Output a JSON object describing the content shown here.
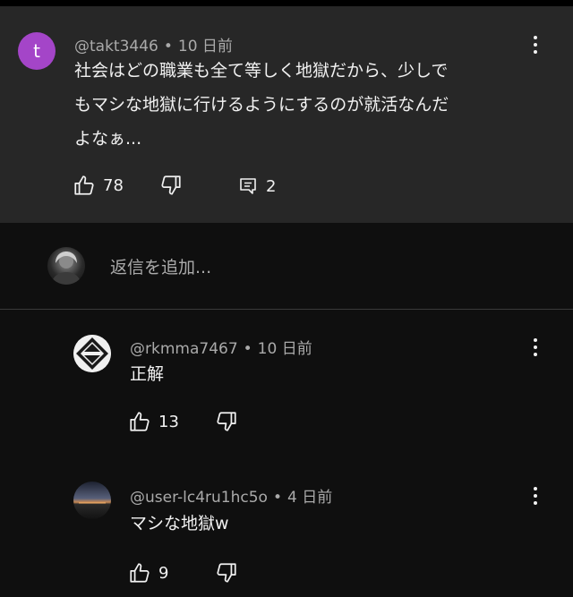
{
  "main_comment": {
    "avatar_letter": "t",
    "author": "@takt3446",
    "time": "10 日前",
    "lines": [
      "社会はどの職業も全て等しく地獄だから、少しで",
      "もマシな地獄に行けるようにするのが就活なんだ",
      "よなぁ..."
    ],
    "likes": "78",
    "replies": "2"
  },
  "reply_box": {
    "placeholder": "返信を追加..."
  },
  "replies": [
    {
      "author": "@rkmma7467",
      "time": "10 日前",
      "text": "正解",
      "likes": "13"
    },
    {
      "author": "@user-lc4ru1hc5o",
      "time": "4 日前",
      "text": "マシな地獄w",
      "likes": "9"
    }
  ],
  "colors": {
    "avatar_bg": "#a445c8",
    "highlight_bg": "#272727",
    "page_bg": "#0f0f0f"
  },
  "separator": "•"
}
